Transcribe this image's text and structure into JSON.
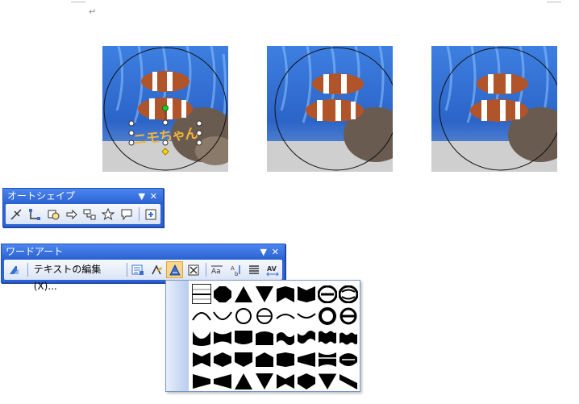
{
  "document": {
    "paragraph_mark": "↵"
  },
  "wordart_text": "ニモちゃん",
  "colors": {
    "titlebar": "#2c63d6",
    "wordart_text": "#f0b43a"
  },
  "autoshape_toolbar": {
    "title": "オートシェイプ",
    "buttons": [
      "draw-icon",
      "connector-icon",
      "rectangle-icon",
      "arrow-icon",
      "flowchart-icon",
      "star-icon",
      "callout-icon",
      "more-shapes-icon"
    ]
  },
  "wordart_toolbar": {
    "title": "ワードアート",
    "edit_text_label": "テキストの編集(X)...",
    "buttons_left": [
      "insert-wordart-icon"
    ],
    "buttons_right": [
      "wordart-gallery-icon",
      "format-wordart-icon",
      "wordart-shape-icon",
      "text-wrapping-icon",
      "same-height-icon",
      "vertical-text-icon",
      "alignment-icon",
      "character-spacing-icon"
    ]
  },
  "shape_palette": {
    "rows": 5,
    "cols": 8,
    "selected_index": 0
  }
}
